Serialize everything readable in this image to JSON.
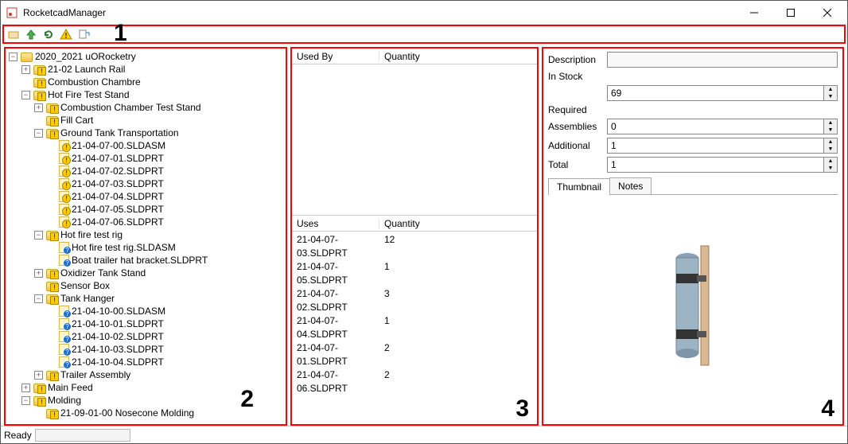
{
  "window": {
    "title": "RocketcadManager"
  },
  "annotations": {
    "n1": "1",
    "n2": "2",
    "n3": "3",
    "n4": "4"
  },
  "tree": {
    "root": "2020_2021 uORocketry",
    "items": [
      {
        "depth": 1,
        "exp": "+",
        "icon": "folder-warn",
        "label": "21-02 Launch Rail"
      },
      {
        "depth": 1,
        "exp": "",
        "icon": "folder-warn",
        "label": "Combustion Chambre"
      },
      {
        "depth": 1,
        "exp": "-",
        "icon": "folder-warn",
        "label": "Hot Fire Test Stand"
      },
      {
        "depth": 2,
        "exp": "+",
        "icon": "folder-warn",
        "label": "Combustion Chamber Test Stand"
      },
      {
        "depth": 2,
        "exp": "",
        "icon": "folder-warn",
        "label": "Fill Cart"
      },
      {
        "depth": 2,
        "exp": "-",
        "icon": "folder-warn",
        "label": "Ground Tank Transportation"
      },
      {
        "depth": 3,
        "exp": "",
        "icon": "file-warn",
        "label": "21-04-07-00.SLDASM"
      },
      {
        "depth": 3,
        "exp": "",
        "icon": "file-warn",
        "label": "21-04-07-01.SLDPRT"
      },
      {
        "depth": 3,
        "exp": "",
        "icon": "file-warn",
        "label": "21-04-07-02.SLDPRT"
      },
      {
        "depth": 3,
        "exp": "",
        "icon": "file-warn",
        "label": "21-04-07-03.SLDPRT"
      },
      {
        "depth": 3,
        "exp": "",
        "icon": "file-warn",
        "label": "21-04-07-04.SLDPRT"
      },
      {
        "depth": 3,
        "exp": "",
        "icon": "file-warn",
        "label": "21-04-07-05.SLDPRT"
      },
      {
        "depth": 3,
        "exp": "",
        "icon": "file-warn",
        "label": "21-04-07-06.SLDPRT"
      },
      {
        "depth": 2,
        "exp": "-",
        "icon": "folder-warn",
        "label": "Hot fire test rig"
      },
      {
        "depth": 3,
        "exp": "",
        "icon": "file-q",
        "label": "Hot fire test rig.SLDASM"
      },
      {
        "depth": 3,
        "exp": "",
        "icon": "file-q",
        "label": "Boat trailer hat bracket.SLDPRT"
      },
      {
        "depth": 2,
        "exp": "+",
        "icon": "folder-warn",
        "label": "Oxidizer Tank Stand"
      },
      {
        "depth": 2,
        "exp": "",
        "icon": "folder-warn",
        "label": "Sensor Box"
      },
      {
        "depth": 2,
        "exp": "-",
        "icon": "folder-warn",
        "label": "Tank Hanger"
      },
      {
        "depth": 3,
        "exp": "",
        "icon": "file-q",
        "label": "21-04-10-00.SLDASM"
      },
      {
        "depth": 3,
        "exp": "",
        "icon": "file-q",
        "label": "21-04-10-01.SLDPRT"
      },
      {
        "depth": 3,
        "exp": "",
        "icon": "file-q",
        "label": "21-04-10-02.SLDPRT"
      },
      {
        "depth": 3,
        "exp": "",
        "icon": "file-q",
        "label": "21-04-10-03.SLDPRT"
      },
      {
        "depth": 3,
        "exp": "",
        "icon": "file-q",
        "label": "21-04-10-04.SLDPRT"
      },
      {
        "depth": 2,
        "exp": "+",
        "icon": "folder-warn",
        "label": "Trailer Assembly"
      },
      {
        "depth": 1,
        "exp": "+",
        "icon": "folder-warn",
        "label": "Main Feed"
      },
      {
        "depth": 1,
        "exp": "-",
        "icon": "folder-warn",
        "label": "Molding"
      },
      {
        "depth": 2,
        "exp": "",
        "icon": "folder-warn",
        "label": "21-09-01-00 Nosecone Molding"
      }
    ]
  },
  "usedby": {
    "h1": "Used By",
    "h2": "Quantity",
    "rows": []
  },
  "uses": {
    "h1": "Uses",
    "h2": "Quantity",
    "rows": [
      {
        "name": "21-04-07-03.SLDPRT",
        "qty": "12"
      },
      {
        "name": "21-04-07-05.SLDPRT",
        "qty": "1"
      },
      {
        "name": "21-04-07-02.SLDPRT",
        "qty": "3"
      },
      {
        "name": "21-04-07-04.SLDPRT",
        "qty": "1"
      },
      {
        "name": "21-04-07-01.SLDPRT",
        "qty": "2"
      },
      {
        "name": "21-04-07-06.SLDPRT",
        "qty": "2"
      }
    ]
  },
  "props": {
    "description_label": "Description",
    "description_value": "",
    "instock_label": "In Stock",
    "instock_value": "69",
    "required_label": "Required",
    "assemblies_label": "Assemblies",
    "assemblies_value": "0",
    "additional_label": "Additional",
    "additional_value": "1",
    "total_label": "Total",
    "total_value": "1",
    "tab_thumb": "Thumbnail",
    "tab_notes": "Notes"
  },
  "status": {
    "ready": "Ready"
  }
}
